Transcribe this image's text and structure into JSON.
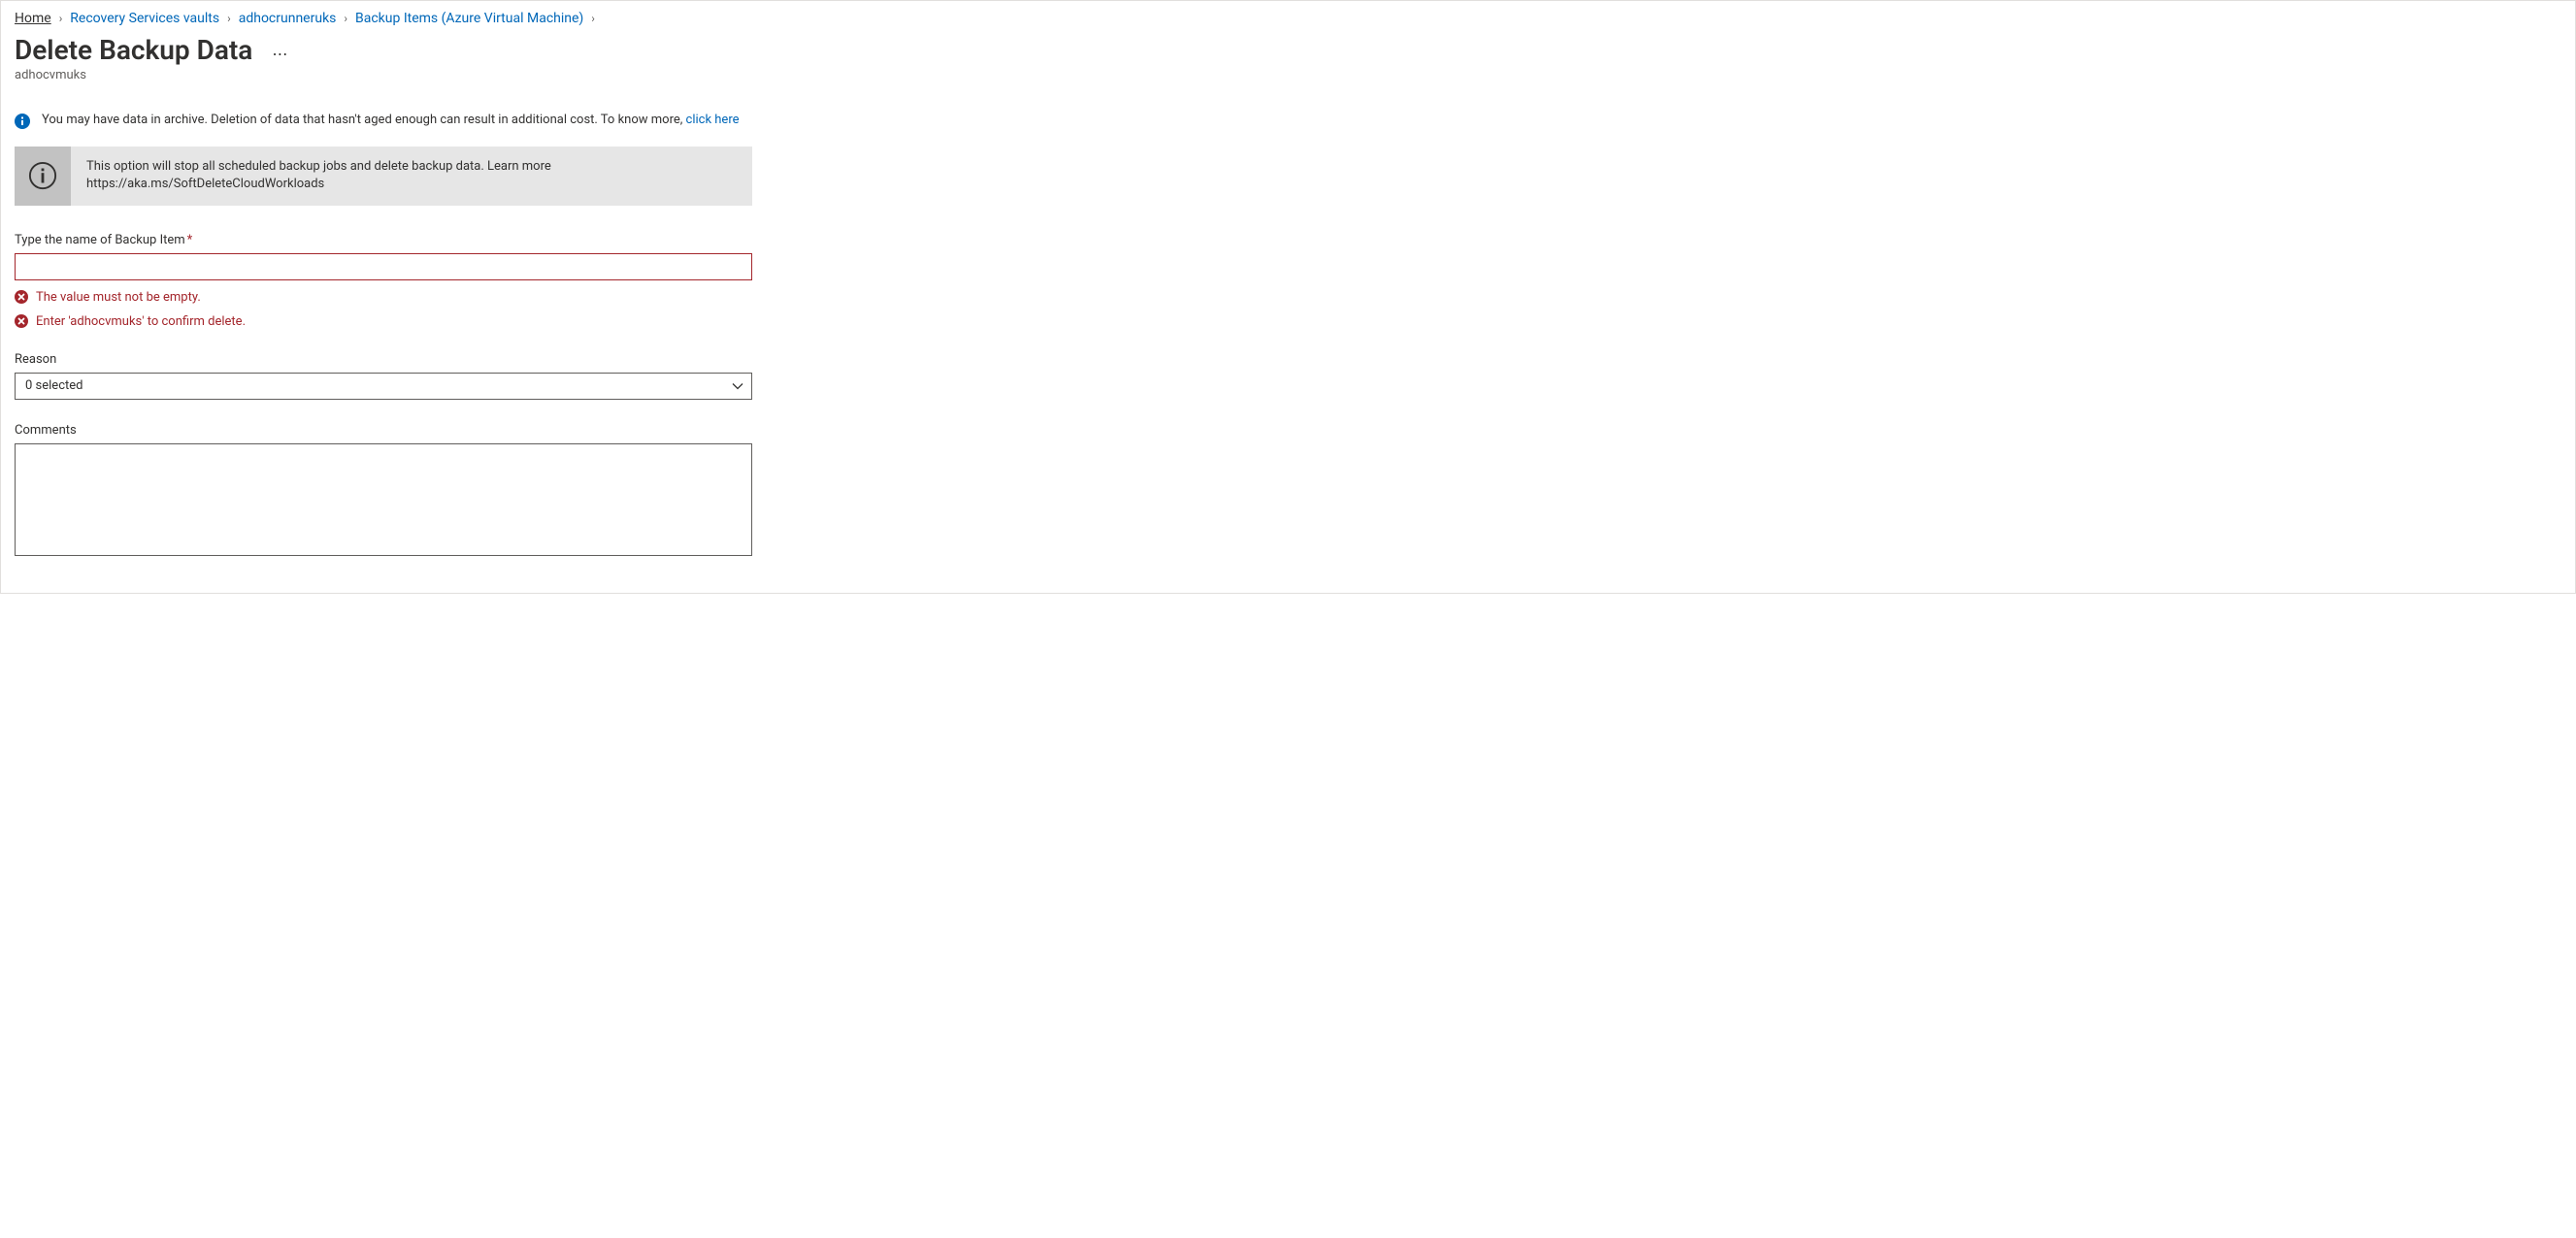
{
  "breadcrumb": {
    "items": [
      {
        "label": "Home",
        "home": true
      },
      {
        "label": "Recovery Services vaults"
      },
      {
        "label": "adhocrunneruks"
      },
      {
        "label": "Backup Items (Azure Virtual Machine)"
      }
    ]
  },
  "header": {
    "title": "Delete Backup Data",
    "subtitle": "adhocvmuks"
  },
  "banner1": {
    "text_before_link": "You may have data in archive. Deletion of data that hasn't aged enough can result in additional cost. To know more, ",
    "link_text": "click here"
  },
  "banner2": {
    "line1": "This option will stop all scheduled backup jobs and delete backup data. Learn more",
    "line2": "https://aka.ms/SoftDeleteCloudWorkloads"
  },
  "form": {
    "name_label": "Type the name of Backup Item",
    "name_value": "",
    "validation1": "The value must not be empty.",
    "validation2": "Enter 'adhocvmuks' to confirm delete.",
    "reason_label": "Reason",
    "reason_selected": "0 selected",
    "comments_label": "Comments",
    "comments_value": ""
  }
}
